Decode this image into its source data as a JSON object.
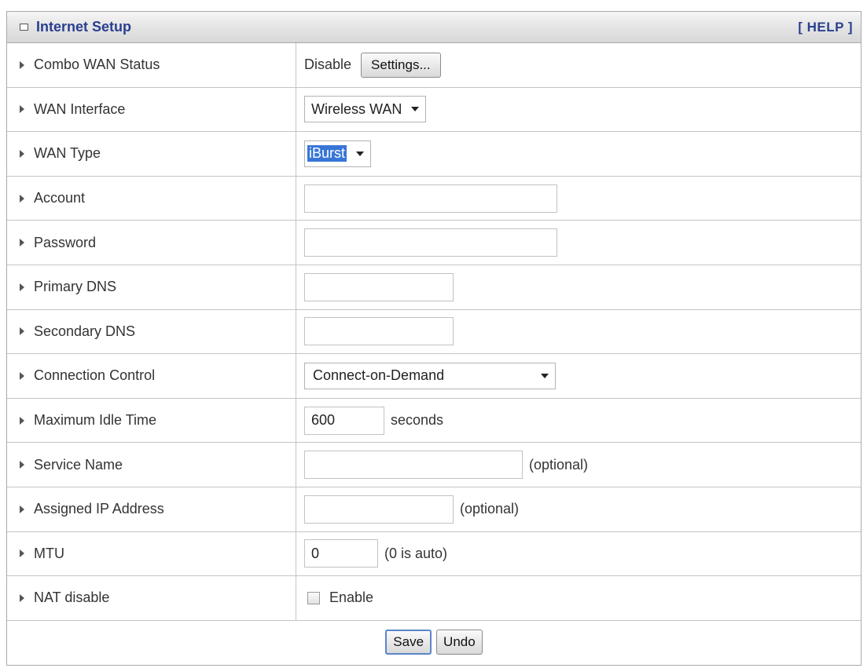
{
  "header": {
    "title": "Internet Setup",
    "help_label": "[ HELP ]"
  },
  "rows": {
    "combo_wan": {
      "label": "Combo WAN Status",
      "status": "Disable",
      "button": "Settings..."
    },
    "wan_interface": {
      "label": "WAN Interface",
      "selected": "Wireless WAN"
    },
    "wan_type": {
      "label": "WAN Type",
      "selected": "iBurst"
    },
    "account": {
      "label": "Account",
      "value": ""
    },
    "password": {
      "label": "Password",
      "value": ""
    },
    "primary_dns": {
      "label": "Primary DNS",
      "value": ""
    },
    "secondary_dns": {
      "label": "Secondary DNS",
      "value": ""
    },
    "connection_control": {
      "label": "Connection Control",
      "selected": "Connect-on-Demand"
    },
    "max_idle": {
      "label": "Maximum Idle Time",
      "value": "600",
      "suffix": "seconds"
    },
    "service_name": {
      "label": "Service Name",
      "value": "",
      "suffix": "(optional)"
    },
    "assigned_ip": {
      "label": "Assigned IP Address",
      "value": "",
      "suffix": "(optional)"
    },
    "mtu": {
      "label": "MTU",
      "value": "0",
      "suffix": "(0 is auto)"
    },
    "nat_disable": {
      "label": "NAT disable",
      "checkbox_label": "Enable",
      "checked": false
    }
  },
  "footer": {
    "save_label": "Save",
    "undo_label": "Undo"
  },
  "icons": {
    "header_icon": "square-icon",
    "row_marker": "triangle-right-icon",
    "dropdown": "caret-down-icon"
  },
  "colors": {
    "title": "#2a3f8f",
    "selection": "#3875d7"
  }
}
